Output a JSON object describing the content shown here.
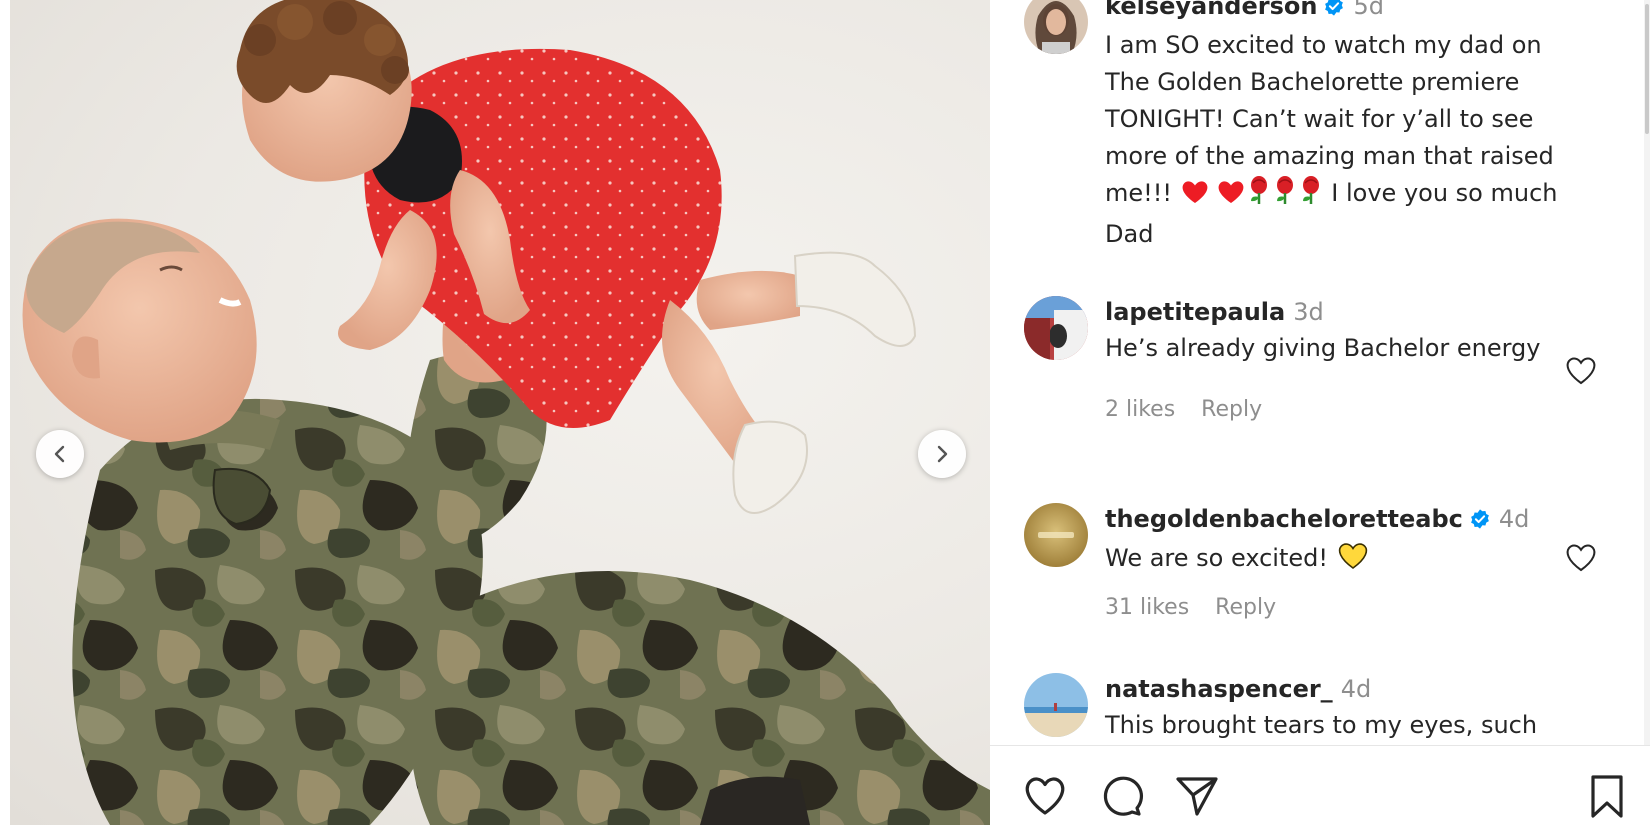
{
  "post": {
    "carousel": {
      "prev_label": "Previous",
      "next_label": "Next"
    },
    "caption": {
      "username": "kelseyanderson",
      "verified": true,
      "time": "5d",
      "text_main": "I am SO excited to watch my dad on The Golden Bachelorette premiere TONIGHT! Can’t wait for y’all to see more of the amazing man that raised me!!!",
      "emoji": [
        "heart",
        "heart",
        "rose",
        "rose",
        "rose"
      ],
      "text_tail": "I love you so much Dad"
    }
  },
  "comments": [
    {
      "username": "lapetitepaula",
      "verified": false,
      "time": "3d",
      "text": "He’s already giving Bachelor energy",
      "likes": "2 likes",
      "reply_label": "Reply"
    },
    {
      "username": "thegoldenbacheloretteabc",
      "verified": true,
      "time": "4d",
      "text": "We are so excited!",
      "emoji": [
        "yellow-heart"
      ],
      "likes": "31 likes",
      "reply_label": "Reply"
    },
    {
      "username": "natashaspencer_",
      "verified": false,
      "time": "4d",
      "text": "This brought tears to my eyes, such"
    }
  ],
  "colors": {
    "verified_blue": "#0095f6",
    "text_primary": "#262626",
    "text_secondary": "#8e8e8e",
    "heart_red": "#ed1c24",
    "yellow_heart": "#ffd83b"
  },
  "icons": {
    "actions": [
      "heart-icon",
      "comment-icon",
      "share-icon",
      "bookmark-icon"
    ]
  }
}
